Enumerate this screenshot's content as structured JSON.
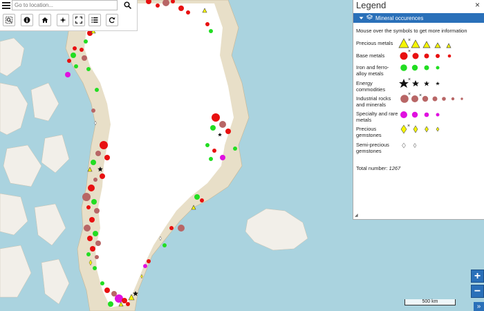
{
  "search": {
    "placeholder": "Go to location..."
  },
  "toolbar": {
    "buttons": [
      "zoom-to-extent",
      "info",
      "home",
      "navigate",
      "fullscreen",
      "layer-list",
      "refresh"
    ]
  },
  "legend": {
    "title": "Legend",
    "close_label": "×",
    "layer_name": "Mineral occurences",
    "hint": "Mouse over the symbols to get more information",
    "categories": [
      {
        "label": "Precious metals",
        "symbol": "triangle",
        "fill": "#f5f500"
      },
      {
        "label": "Base metals",
        "symbol": "circle",
        "fill": "#e81010"
      },
      {
        "label": "Iron and ferro-alloy metals",
        "symbol": "circle",
        "fill": "#22dd22"
      },
      {
        "label": "Energy commodities",
        "symbol": "star",
        "fill": "#111111"
      },
      {
        "label": "Industrial rocks and minerals",
        "symbol": "circle",
        "fill": "#b86666"
      },
      {
        "label": "Specialty and rare metals",
        "symbol": "circle",
        "fill": "#e010e0"
      },
      {
        "label": "Precious gemstones",
        "symbol": "diamond",
        "fill": "#f5f500"
      },
      {
        "label": "Semi-precious gemstones",
        "symbol": "diamond",
        "fill": "#ffffff"
      }
    ],
    "total_label": "Total number:",
    "total_value": "1267"
  },
  "map": {
    "scale_label": "500 km",
    "zoom_in_label": "+",
    "zoom_out_label": "−",
    "expand_label": "»"
  },
  "colors": {
    "sea": "#aad3df",
    "ice": "#ffffff",
    "land": "#e8dfc8",
    "accent": "#2a70b9"
  }
}
